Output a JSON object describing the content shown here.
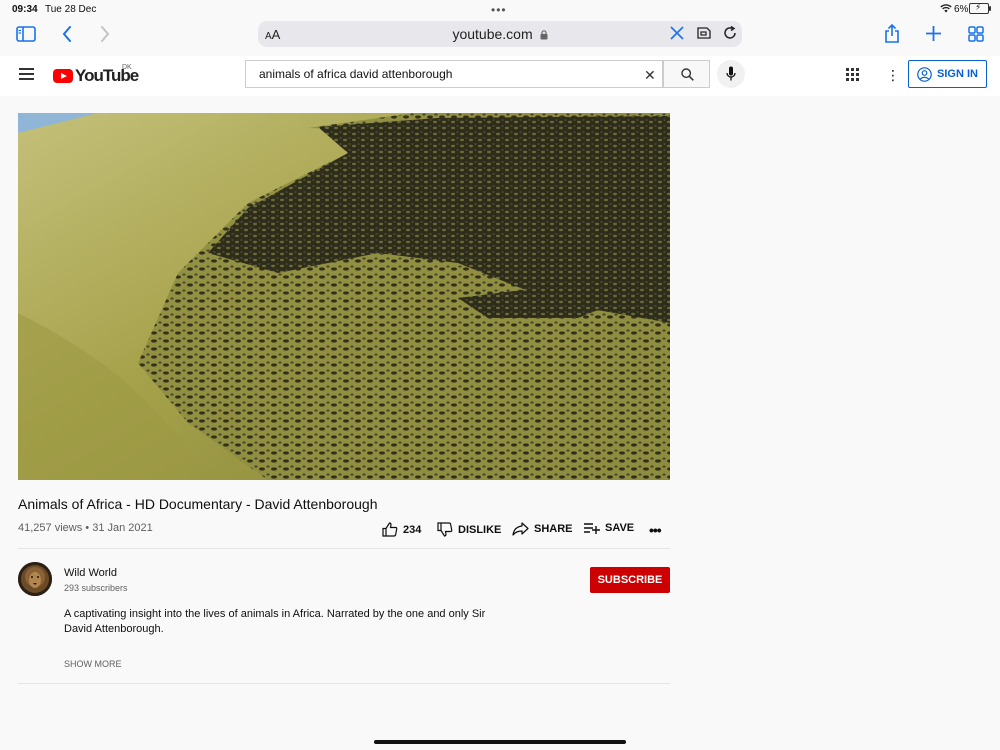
{
  "status_bar": {
    "time": "09:34",
    "date": "Tue 28 Dec",
    "battery": "6%"
  },
  "browser": {
    "aa_label_small": "A",
    "aa_label_large": "A",
    "url": "youtube.com"
  },
  "header": {
    "logo_text": "YouTube",
    "country_code": "DK",
    "search_value": "animals of africa david attenborough",
    "signin_label": "SIGN IN"
  },
  "video": {
    "title": "Animals of Africa - HD Documentary - David Attenborough",
    "views": "41,257 views",
    "separator": "•",
    "date": "31 Jan 2021",
    "like_count": "234",
    "dislike_label": "DISLIKE",
    "share_label": "SHARE",
    "save_label": "SAVE"
  },
  "channel": {
    "name": "Wild World",
    "subscribers": "293 subscribers",
    "subscribe_label": "SUBSCRIBE",
    "description": "A captivating insight into the lives of animals in Africa. Narrated by the one and only Sir David Attenborough.",
    "show_more": "SHOW MORE"
  },
  "colors": {
    "accent": "#1a73e8",
    "yt_red": "#ff0000",
    "subscribe_red": "#cc0000",
    "signin_blue": "#065fd4"
  }
}
